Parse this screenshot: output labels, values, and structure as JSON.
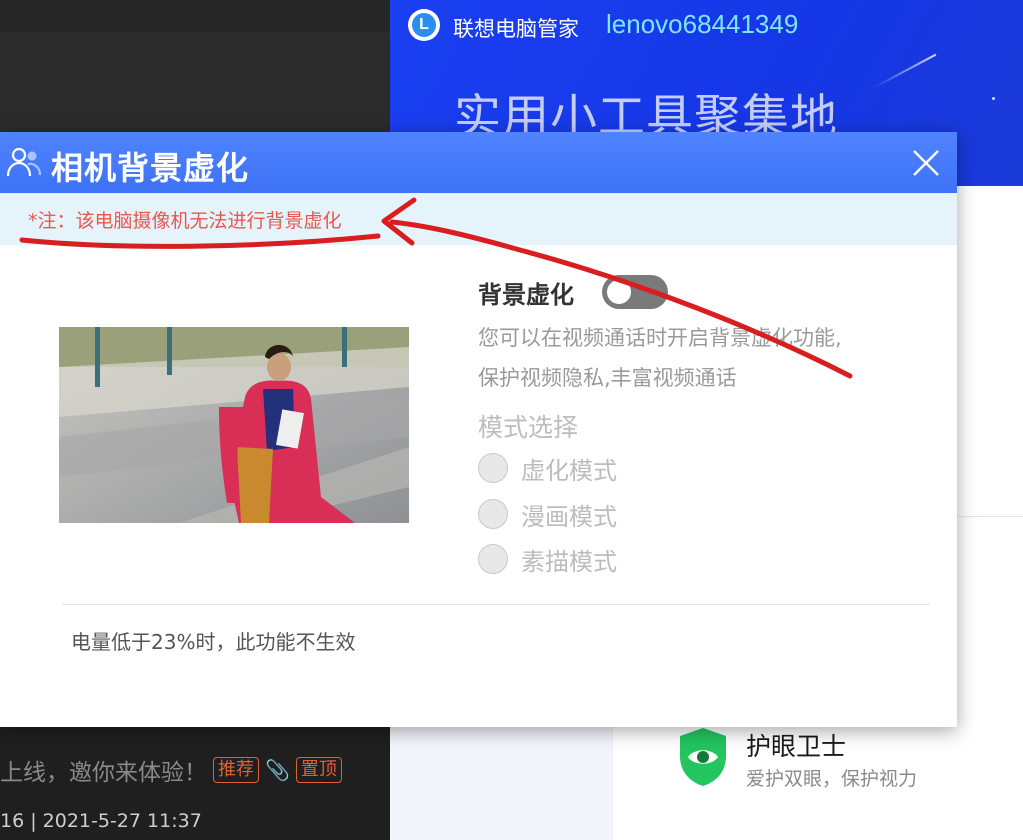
{
  "background_forum": {
    "post_text": "上线，邀你来体验！",
    "tag_recommend": "推荐",
    "tag_pinned": "置顶",
    "meta": "16 | 2021-5-27 11:37"
  },
  "lenovo": {
    "app_name": "联想电脑管家",
    "username": "lenovo68441349",
    "banner": "实用小工具聚集地",
    "eye_care": {
      "title": "护眼卫士",
      "subtitle": "爱护双眼，保护视力"
    }
  },
  "dialog": {
    "title": "相机背景虚化",
    "notice": "*注：该电脑摄像机无法进行背景虚化",
    "section_title": "背景虚化",
    "toggle_on": false,
    "description_lines": [
      "您可以在视频通话时开启背景虚化功能,",
      "保护视频隐私,丰富视频通话"
    ],
    "mode_title": "模式选择",
    "modes": [
      {
        "label": "虚化模式"
      },
      {
        "label": "漫画模式"
      },
      {
        "label": "素描模式"
      }
    ],
    "footer_note": "电量低于23%时，此功能不生效"
  },
  "colors": {
    "titlebar_blue": "#3d72f5",
    "notice_bg": "#e5f3fb",
    "notice_red": "#e8584f",
    "annotation_red": "#d81e1e",
    "lenovo_blue": "#1537e6"
  }
}
